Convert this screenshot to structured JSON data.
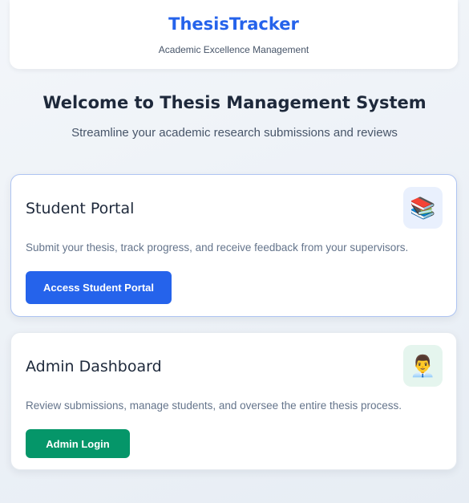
{
  "header": {
    "brand": "ThesisTracker",
    "tagline": "Academic Excellence Management"
  },
  "hero": {
    "title": "Welcome to Thesis Management System",
    "subtitle": "Streamline your academic research submissions and reviews"
  },
  "cards": {
    "student": {
      "title": "Student Portal",
      "description": "Submit your thesis, track progress, and receive feedback from your supervisors.",
      "button_label": "Access Student Portal",
      "icon": "books-icon",
      "accent": "#2563eb"
    },
    "admin": {
      "title": "Admin Dashboard",
      "description": "Review submissions, manage students, and oversee the entire thesis process.",
      "button_label": "Admin Login",
      "icon": "admin-person-icon",
      "accent": "#059669"
    }
  }
}
